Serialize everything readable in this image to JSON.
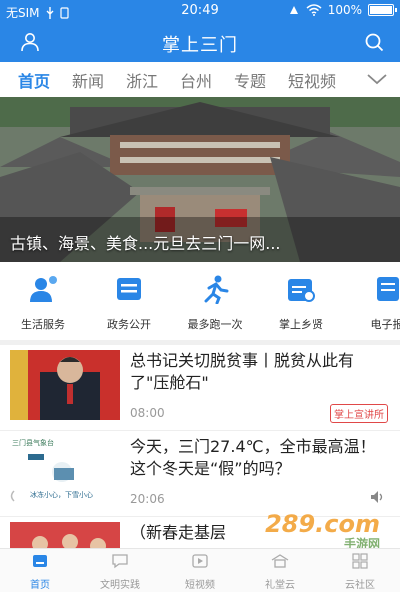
{
  "status_bar": {
    "carrier": "无SIM",
    "time": "20:49",
    "battery_text": "100%",
    "battery_level": 1.0
  },
  "header": {
    "title": "掌上三门",
    "icons": [
      "user-icon",
      "search-icon"
    ]
  },
  "tabs": [
    {
      "label": "首页",
      "active": true
    },
    {
      "label": "新闻",
      "active": false
    },
    {
      "label": "浙江",
      "active": false
    },
    {
      "label": "台州",
      "active": false
    },
    {
      "label": "专题",
      "active": false
    },
    {
      "label": "短视频",
      "active": false
    }
  ],
  "hero": {
    "caption": "古镇、海景、美食...元旦去三门一网..."
  },
  "services": [
    {
      "label": "生活服务",
      "icon": "life-service-icon"
    },
    {
      "label": "政务公开",
      "icon": "government-icon"
    },
    {
      "label": "最多跑一次",
      "icon": "running-icon"
    },
    {
      "label": "掌上乡贤",
      "icon": "calendar-icon"
    },
    {
      "label": "电子报",
      "icon": "epaper-icon"
    }
  ],
  "news": [
    {
      "title": "总书记关切脱贫事丨脱贫从此有了\"压舱石\"",
      "time": "08:00",
      "tag": "掌上宣讲所"
    },
    {
      "title": "今天，三门27.4℃，全市最高温！这个冬天是“假”的吗？",
      "time": "20:06",
      "thumb_text_top": "三门县气象台",
      "thumb_text_bottom": "冰冻小心，下雪小心"
    },
    {
      "title": "（新春走基层",
      "time": ""
    }
  ],
  "watermark": {
    "text": "289.com",
    "sub": "手游网"
  },
  "bottom_nav": [
    {
      "label": "首页",
      "active": true,
      "icon": "home-icon"
    },
    {
      "label": "文明实践",
      "active": false,
      "icon": "chat-icon"
    },
    {
      "label": "短视频",
      "active": false,
      "icon": "video-icon"
    },
    {
      "label": "礼堂云",
      "active": false,
      "icon": "hall-icon"
    },
    {
      "label": "云社区",
      "active": false,
      "icon": "community-icon"
    }
  ],
  "colors": {
    "brand_blue": "#2a86e6",
    "tag_red": "#e04848",
    "muted": "#999999"
  }
}
